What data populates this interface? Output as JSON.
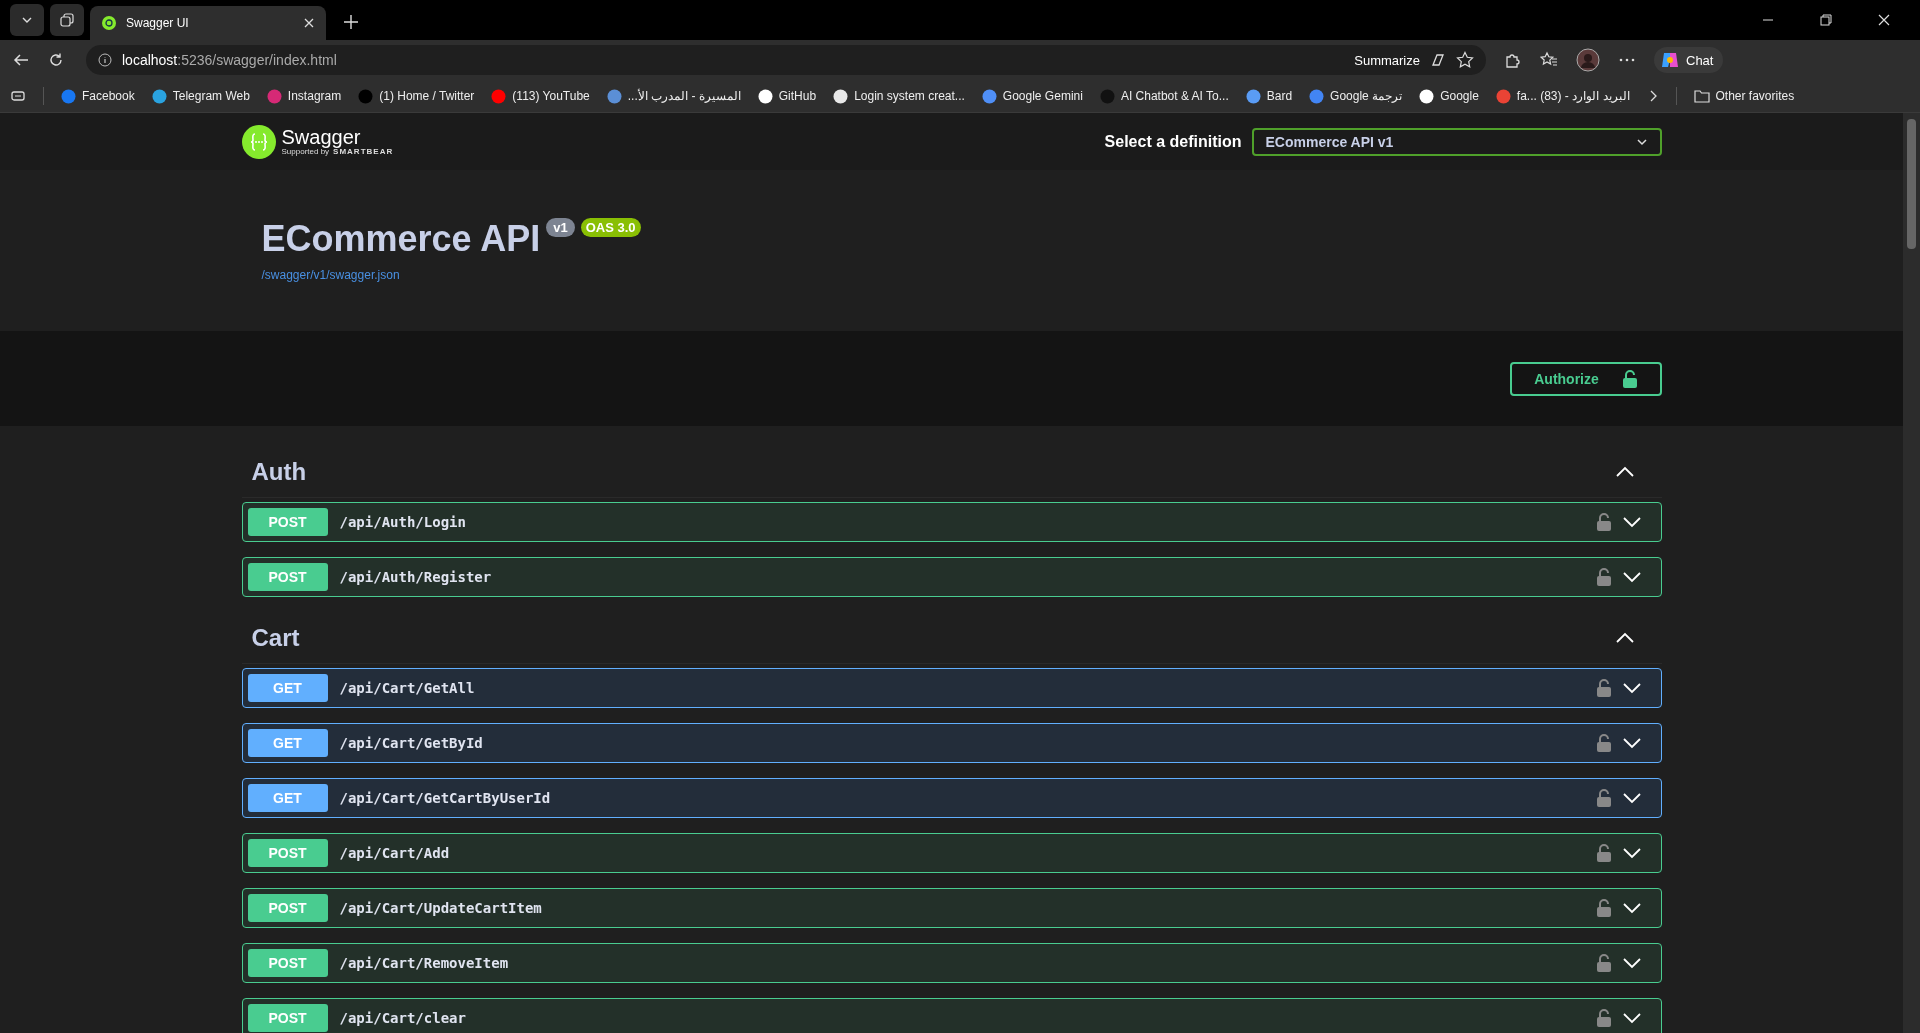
{
  "browser": {
    "tabs": [
      {
        "title": "Swagger UI",
        "selected": true
      }
    ],
    "url": {
      "host": "localhost",
      "path": ":5236/swagger/index.html"
    },
    "summarize": "Summarize",
    "chat": "Chat",
    "bookmarks": [
      {
        "label": "Facebook",
        "color": "#1877f2"
      },
      {
        "label": "Telegram Web",
        "color": "#2aa3e0"
      },
      {
        "label": "Instagram",
        "color": "#d62976"
      },
      {
        "label": "(1) Home / Twitter",
        "color": "#000000"
      },
      {
        "label": "(113) YouTube",
        "color": "#ff0000"
      },
      {
        "label": "المسيرة - المدرب الأ...",
        "color": "#5b8fd6"
      },
      {
        "label": "GitHub",
        "color": "#ffffff"
      },
      {
        "label": "Login system creat...",
        "color": "#e8e8e8"
      },
      {
        "label": "Google Gemini",
        "color": "#4f8ff7"
      },
      {
        "label": "AI Chatbot & AI To...",
        "color": "#111111"
      },
      {
        "label": "Bard",
        "color": "#5a9cf5"
      },
      {
        "label": "Google ترجمة",
        "color": "#4285f4"
      },
      {
        "label": "Google",
        "color": "#ffffff"
      },
      {
        "label": "البريد الوارد - fa... (83)",
        "color": "#ea4335"
      }
    ],
    "other_favorites": "Other favorites"
  },
  "swagger": {
    "brand": "Swagger",
    "supported_by": "Supported by",
    "smartbear": "SMARTBEAR",
    "definition_label": "Select a definition",
    "definition_value": "ECommerce API v1",
    "title": "ECommerce API",
    "version": "v1",
    "oas": "OAS 3.0",
    "spec_link": "/swagger/v1/swagger.json",
    "authorize": "Authorize",
    "sections": [
      {
        "name": "Auth",
        "expanded": true,
        "operations": [
          {
            "method": "POST",
            "path": "/api/Auth/Login"
          },
          {
            "method": "POST",
            "path": "/api/Auth/Register"
          }
        ]
      },
      {
        "name": "Cart",
        "expanded": true,
        "operations": [
          {
            "method": "GET",
            "path": "/api/Cart/GetAll"
          },
          {
            "method": "GET",
            "path": "/api/Cart/GetById"
          },
          {
            "method": "GET",
            "path": "/api/Cart/GetCartByUserId"
          },
          {
            "method": "POST",
            "path": "/api/Cart/Add"
          },
          {
            "method": "POST",
            "path": "/api/Cart/UpdateCartItem"
          },
          {
            "method": "POST",
            "path": "/api/Cart/RemoveItem"
          },
          {
            "method": "POST",
            "path": "/api/Cart/clear"
          }
        ]
      }
    ]
  }
}
